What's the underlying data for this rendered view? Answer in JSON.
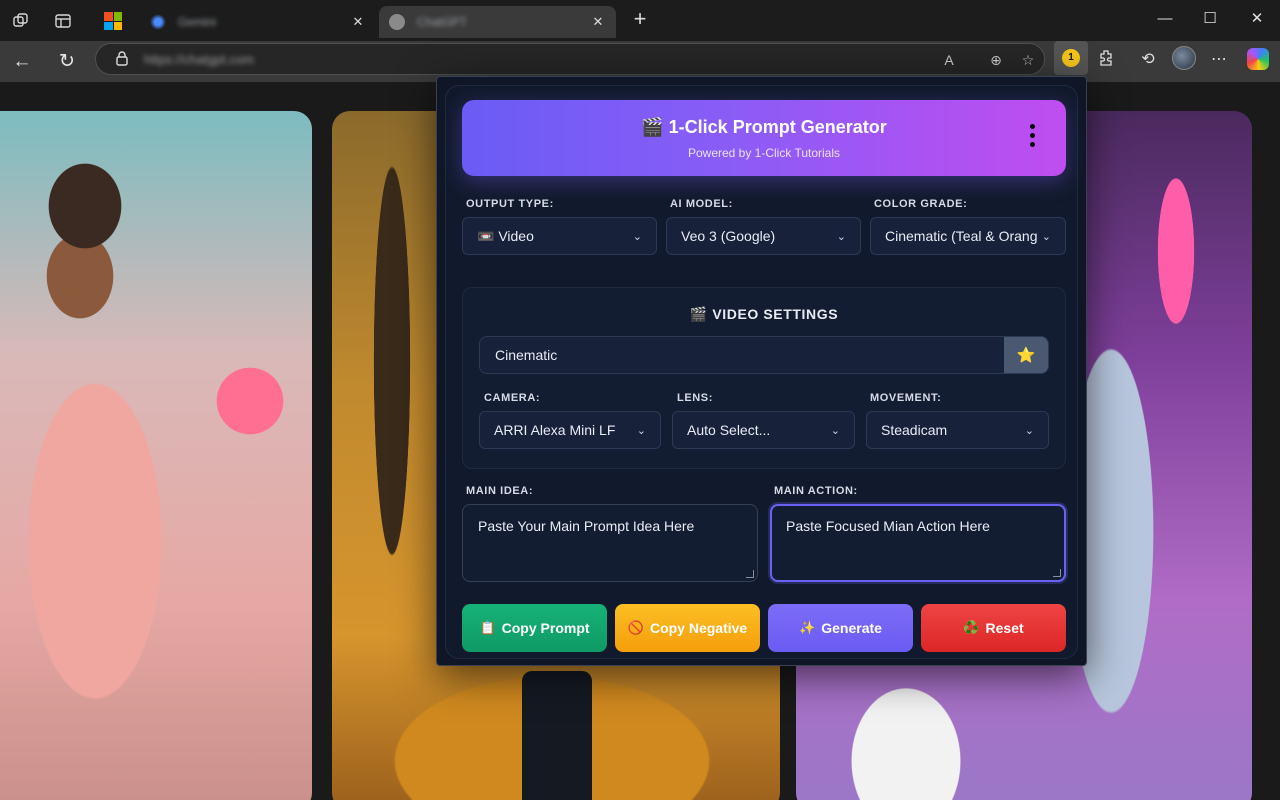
{
  "browser": {
    "tabs": [
      {
        "title": "Gemini",
        "active": false
      },
      {
        "title": "ChatGPT",
        "active": true
      }
    ],
    "address": "https://chatgpt.com",
    "icons": {
      "workspaces": "workspaces-icon",
      "tab_actions": "tab-actions-icon",
      "back": "←",
      "refresh": "↻",
      "lock": "🔒",
      "read_aloud": "A",
      "zoom": "⊕",
      "favorite": "☆",
      "extensions": "⧉",
      "history": "⟲",
      "more": "⋯",
      "new_tab": "+",
      "minimize": "—",
      "maximize": "☐",
      "close": "✕"
    }
  },
  "popup": {
    "header": {
      "title": "🎬 1-Click Prompt Generator",
      "subtitle": "Powered by 1-Click Tutorials"
    },
    "fields": {
      "output_type": {
        "label": "OUTPUT TYPE:",
        "value": "📼 Video"
      },
      "ai_model": {
        "label": "AI MODEL:",
        "value": "Veo 3 (Google)"
      },
      "color_grade": {
        "label": "COLOR GRADE:",
        "value": "Cinematic (Teal & Orange)"
      }
    },
    "video_settings": {
      "title": "🎬 VIDEO SETTINGS",
      "style_value": "Cinematic",
      "star_icon": "⭐",
      "camera": {
        "label": "CAMERA:",
        "value": "ARRI Alexa Mini LF"
      },
      "lens": {
        "label": "LENS:",
        "value": "Auto Select..."
      },
      "movement": {
        "label": "MOVEMENT:",
        "value": "Steadicam"
      }
    },
    "main_idea": {
      "label": "MAIN IDEA:",
      "value": "Paste Your Main Prompt Idea Here"
    },
    "main_action": {
      "label": "MAIN ACTION:",
      "value": "Paste Focused Mian Action Here"
    },
    "buttons": {
      "copy_prompt": {
        "icon": "📋",
        "label": "Copy Prompt"
      },
      "copy_negative": {
        "icon": "🚫",
        "label": "Copy Negative"
      },
      "generate": {
        "icon": "✨",
        "label": "Generate"
      },
      "reset": {
        "icon": "♻️",
        "label": "Reset"
      }
    },
    "colors": {
      "header_start": "#6a5cf5",
      "header_end": "#c04df0",
      "copy_prompt": "#10a36e",
      "copy_negative": "#f59e0b",
      "generate": "#6a5cf2",
      "reset": "#dc2626",
      "focus_border": "#6a63f2"
    }
  }
}
